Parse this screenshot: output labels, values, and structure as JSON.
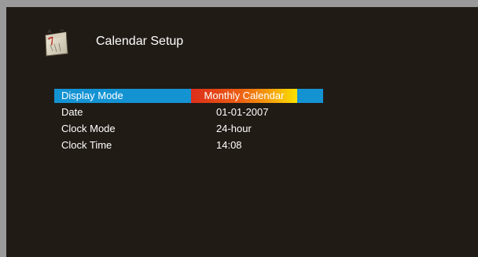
{
  "header": {
    "title": "Calendar Setup",
    "icon": "calendar-icon",
    "icon_text": "7"
  },
  "settings": [
    {
      "label": "Display Mode",
      "value": "Monthly Calendar",
      "selected": true
    },
    {
      "label": "Date",
      "value": "01-01-2007",
      "selected": false
    },
    {
      "label": "Clock Mode",
      "value": "24-hour",
      "selected": false
    },
    {
      "label": "Clock Time",
      "value": "14:08",
      "selected": false
    }
  ],
  "colors": {
    "panel_background": "#211b16",
    "selected_row": "#1493d3",
    "selected_value_start": "#dc2e1b",
    "selected_value_end": "#fbe200",
    "text": "#ffffff"
  }
}
